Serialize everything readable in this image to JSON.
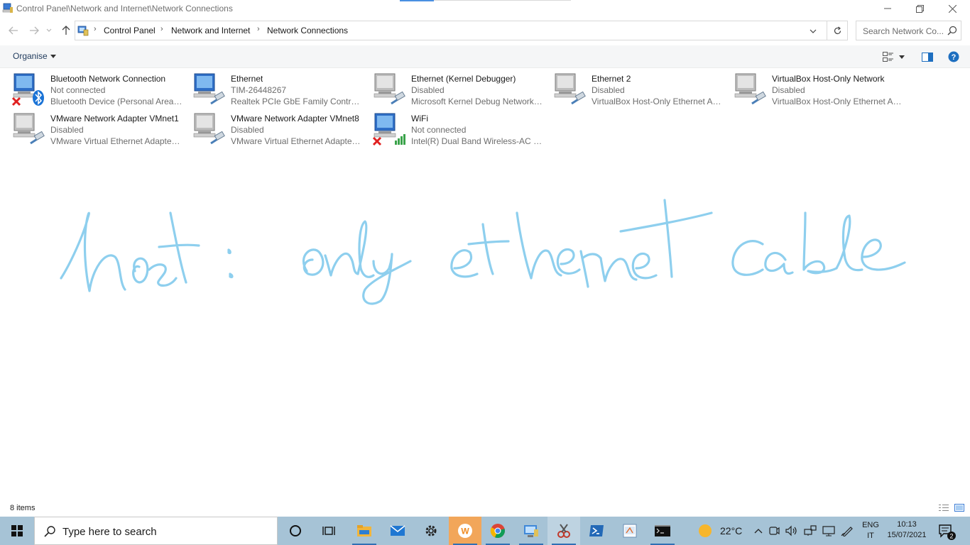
{
  "window": {
    "title": "Control Panel\\Network and Internet\\Network Connections"
  },
  "address": {
    "crumbs": [
      "Control Panel",
      "Network and Internet",
      "Network Connections"
    ]
  },
  "search": {
    "placeholder": "Search Network Co..."
  },
  "commandbar": {
    "organise_label": "Organise"
  },
  "connections": [
    {
      "name": "Bluetooth Network Connection",
      "status": "Not connected",
      "device": "Bluetooth Device (Personal Area ...",
      "icon": "bluetooth-adapter-icon",
      "badge": "red-x"
    },
    {
      "name": "Ethernet",
      "status": "TIM-26448267",
      "device": "Realtek PCIe GbE Family Controller",
      "icon": "ethernet-adapter-icon",
      "badge": "none"
    },
    {
      "name": "Ethernet (Kernel Debugger)",
      "status": "Disabled",
      "device": "Microsoft Kernel Debug Network ...",
      "icon": "ethernet-adapter-icon",
      "badge": "disabled"
    },
    {
      "name": "Ethernet 2",
      "status": "Disabled",
      "device": "VirtualBox Host-Only Ethernet Ad...",
      "icon": "ethernet-adapter-icon",
      "badge": "disabled"
    },
    {
      "name": "VirtualBox Host-Only Network",
      "status": "Disabled",
      "device": "VirtualBox Host-Only Ethernet Ad...",
      "icon": "ethernet-adapter-icon",
      "badge": "disabled"
    },
    {
      "name": "VMware Network Adapter VMnet1",
      "status": "Disabled",
      "device": "VMware Virtual Ethernet Adapter ...",
      "icon": "ethernet-adapter-icon",
      "badge": "disabled"
    },
    {
      "name": "VMware Network Adapter VMnet8",
      "status": "Disabled",
      "device": "VMware Virtual Ethernet Adapter ...",
      "icon": "ethernet-adapter-icon",
      "badge": "disabled"
    },
    {
      "name": "WiFi",
      "status": "Not connected",
      "device": "Intel(R) Dual Band Wireless-AC 82...",
      "icon": "wifi-adapter-icon",
      "badge": "red-x"
    }
  ],
  "annotation": {
    "text": "host : only ethernet cable",
    "color": "#8ecfee"
  },
  "statusbar": {
    "item_count": "8 items"
  },
  "taskbar": {
    "search_placeholder": "Type here to search",
    "apps": [
      "cortana-icon",
      "task-view-icon",
      "file-explorer-icon",
      "mail-icon",
      "settings-icon",
      "app-w-icon",
      "chrome-icon",
      "control-panel-icon",
      "snipping-tool-icon",
      "powershell-icon",
      "paint-icon",
      "terminal-icon"
    ],
    "weather_temp": "22°C",
    "lang_line1": "ENG",
    "lang_line2": "IT",
    "time": "10:13",
    "date": "15/07/2021",
    "notifications": "2"
  }
}
